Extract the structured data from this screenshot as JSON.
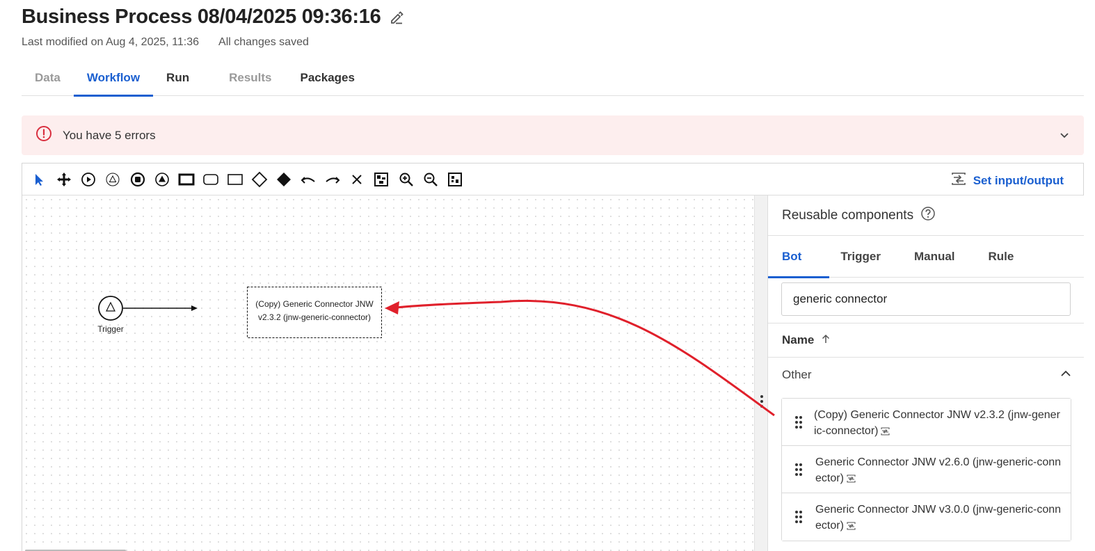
{
  "header": {
    "title": "Business Process 08/04/2025 09:36:16",
    "last_modified": "Last modified on Aug 4, 2025, 11:36",
    "save_status": "All changes saved"
  },
  "tabs": [
    {
      "label": "Data",
      "state": "disabled"
    },
    {
      "label": "Workflow",
      "state": "active"
    },
    {
      "label": "Run",
      "state": "normal"
    },
    {
      "label": "Results",
      "state": "disabled"
    },
    {
      "label": "Packages",
      "state": "normal"
    }
  ],
  "error_banner": {
    "text": "You have 5 errors"
  },
  "toolbar": {
    "tools": [
      "pointer-icon",
      "move-icon",
      "start-event-icon",
      "trigger-event-icon",
      "end-event-icon",
      "escalation-event-icon",
      "task-bold-icon",
      "rounded-task-icon",
      "task-icon",
      "gateway-icon",
      "filled-gateway-icon",
      "undo-icon",
      "redo-icon",
      "delete-icon",
      "layout-icon",
      "zoom-in-icon",
      "zoom-out-icon",
      "fit-icon"
    ],
    "set_io_label": "Set input/output"
  },
  "canvas": {
    "trigger_label": "Trigger",
    "task_line1": "(Copy) Generic Connector JNW",
    "task_line2": "v2.3.2  (jnw-generic-connector)"
  },
  "panel": {
    "title": "Reusable components",
    "tabs": [
      "Bot",
      "Trigger",
      "Manual",
      "Rule"
    ],
    "active_tab": "Bot",
    "search_value": "generic connector",
    "sort_label": "Name",
    "group_label": "Other",
    "items": [
      {
        "name": "(Copy) Generic Connector JNW v2.3.2 (jnw-generic-connector)"
      },
      {
        "name": "Generic Connector JNW v2.6.0 (jnw-generic-connector)"
      },
      {
        "name": "Generic Connector JNW v3.0.0 (jnw-generic-connector)"
      }
    ]
  },
  "colors": {
    "accent": "#1a5fd0",
    "error_bg": "#fdeeee",
    "error_icon": "#d93040",
    "annotation_arrow": "#e0202b"
  }
}
